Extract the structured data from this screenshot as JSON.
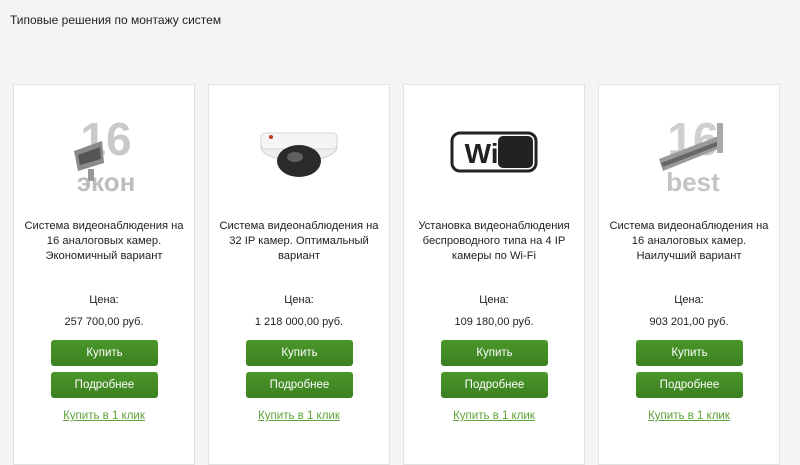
{
  "page_title": "Типовые решения по монтажу систем",
  "cards": [
    {
      "image": "camera-16-econ-image",
      "image_numeral": "16",
      "image_caption": "экон",
      "title": "Система видеонаблюдения на 16 аналоговых камер. Экономичный вариант",
      "price_label": "Цена:",
      "price": "257 700,00 руб.",
      "buy_label": "Купить",
      "details_label": "Подробнее",
      "one_click_label": "Купить в 1 клик"
    },
    {
      "image": "dome-camera-image",
      "title": "Система видеонаблюдения на 32 IP камер. Оптимальный вариант",
      "price_label": "Цена:",
      "price": "1 218 000,00 руб.",
      "buy_label": "Купить",
      "details_label": "Подробнее",
      "one_click_label": "Купить в 1 клик"
    },
    {
      "image": "wifi-logo-image",
      "image_logo_text": "WiFi",
      "title": "Установка видеонаблюдения беспроводного типа на 4 IP камеры по Wi-Fi",
      "price_label": "Цена:",
      "price": "109 180,00 руб.",
      "buy_label": "Купить",
      "details_label": "Подробнее",
      "one_click_label": "Купить в 1 клик"
    },
    {
      "image": "camera-16-best-image",
      "image_numeral": "16",
      "image_caption": "best",
      "title": "Система видеонаблюдения на 16 аналоговых камер. Наилучший вариант",
      "price_label": "Цена:",
      "price": "903 201,00 руб.",
      "buy_label": "Купить",
      "details_label": "Подробнее",
      "one_click_label": "Купить в 1 клик"
    }
  ],
  "colors": {
    "button_green": "#3f8a24",
    "link_green": "#5fa33a",
    "background": "#f4f4f4"
  }
}
